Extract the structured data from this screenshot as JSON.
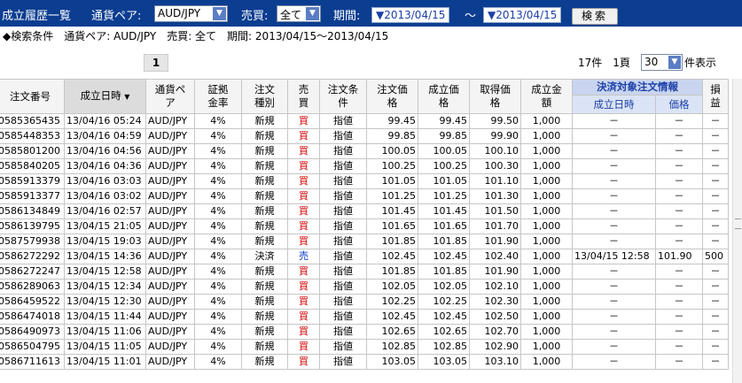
{
  "header": {
    "title": "成立履歴一覧",
    "currency_label": "通貨ペア:",
    "currency_value": "AUD/JPY",
    "side_label": "売買:",
    "side_value": "全て",
    "period_label": "期間:",
    "date_from": "▼2013/04/15",
    "tilde": "～",
    "date_to": "▼2013/04/15",
    "search_button": "検索"
  },
  "conditions": "◆検索条件　通貨ペア: AUD/JPY　売買: 全て　期間: 2013/04/15～2013/04/15",
  "pager": {
    "current_page": "1",
    "summary": "17件　1頁",
    "per_page_value": "30",
    "per_page_suffix": "件表示"
  },
  "table": {
    "headers": {
      "order_no": "注文番号",
      "date": "成立日時",
      "sort_arrow": "▼",
      "pair": [
        "通貨ペ",
        "ア"
      ],
      "margin": [
        "証拠",
        "金率"
      ],
      "type": [
        "注文",
        "種別"
      ],
      "side": [
        "売",
        "買"
      ],
      "condition": [
        "注文条",
        "件"
      ],
      "order_price": [
        "注文価",
        "格"
      ],
      "exec_price": [
        "成立価",
        "格"
      ],
      "acq_price": [
        "取得価",
        "格"
      ],
      "amount": [
        "成立金",
        "額"
      ],
      "settle_group": "決済対象注文情報",
      "settle_date": "成立日時",
      "settle_price": "価格",
      "pl": [
        "損",
        "益"
      ]
    },
    "rows": [
      [
        "0585365435",
        "13/04/16 05:24",
        "AUD/JPY",
        "4%",
        "新規",
        "買",
        "指値",
        "99.45",
        "99.45",
        "99.50",
        "1,000",
        "－",
        "－",
        "－"
      ],
      [
        "0585448353",
        "13/04/16 04:59",
        "AUD/JPY",
        "4%",
        "新規",
        "買",
        "指値",
        "99.85",
        "99.85",
        "99.90",
        "1,000",
        "－",
        "－",
        "－"
      ],
      [
        "0585801200",
        "13/04/16 04:56",
        "AUD/JPY",
        "4%",
        "新規",
        "買",
        "指値",
        "100.05",
        "100.05",
        "100.10",
        "1,000",
        "－",
        "－",
        "－"
      ],
      [
        "0585840205",
        "13/04/16 04:36",
        "AUD/JPY",
        "4%",
        "新規",
        "買",
        "指値",
        "100.25",
        "100.25",
        "100.30",
        "1,000",
        "－",
        "－",
        "－"
      ],
      [
        "0585913379",
        "13/04/16 03:03",
        "AUD/JPY",
        "4%",
        "新規",
        "買",
        "指値",
        "101.05",
        "101.05",
        "101.10",
        "1,000",
        "－",
        "－",
        "－"
      ],
      [
        "0585913377",
        "13/04/16 03:02",
        "AUD/JPY",
        "4%",
        "新規",
        "買",
        "指値",
        "101.25",
        "101.25",
        "101.30",
        "1,000",
        "－",
        "－",
        "－"
      ],
      [
        "0586134849",
        "13/04/16 02:57",
        "AUD/JPY",
        "4%",
        "新規",
        "買",
        "指値",
        "101.45",
        "101.45",
        "101.50",
        "1,000",
        "－",
        "－",
        "－"
      ],
      [
        "0586139795",
        "13/04/15 21:05",
        "AUD/JPY",
        "4%",
        "新規",
        "買",
        "指値",
        "101.65",
        "101.65",
        "101.70",
        "1,000",
        "－",
        "－",
        "－"
      ],
      [
        "0587579938",
        "13/04/15 19:03",
        "AUD/JPY",
        "4%",
        "新規",
        "買",
        "指値",
        "101.85",
        "101.85",
        "101.90",
        "1,000",
        "－",
        "－",
        "－"
      ],
      [
        "0586272292",
        "13/04/15 14:36",
        "AUD/JPY",
        "4%",
        "決済",
        "売",
        "指値",
        "102.45",
        "102.45",
        "102.40",
        "1,000",
        "13/04/15 12:58",
        "101.90",
        "500"
      ],
      [
        "0586272247",
        "13/04/15 12:58",
        "AUD/JPY",
        "4%",
        "新規",
        "買",
        "指値",
        "101.85",
        "101.85",
        "101.90",
        "1,000",
        "－",
        "－",
        "－"
      ],
      [
        "0586289063",
        "13/04/15 12:34",
        "AUD/JPY",
        "4%",
        "新規",
        "買",
        "指値",
        "102.05",
        "102.05",
        "102.10",
        "1,000",
        "－",
        "－",
        "－"
      ],
      [
        "0586459522",
        "13/04/15 12:30",
        "AUD/JPY",
        "4%",
        "新規",
        "買",
        "指値",
        "102.25",
        "102.25",
        "102.30",
        "1,000",
        "－",
        "－",
        "－"
      ],
      [
        "0586474018",
        "13/04/15 11:44",
        "AUD/JPY",
        "4%",
        "新規",
        "買",
        "指値",
        "102.45",
        "102.45",
        "102.50",
        "1,000",
        "－",
        "－",
        "－"
      ],
      [
        "0586490973",
        "13/04/15 11:06",
        "AUD/JPY",
        "4%",
        "新規",
        "買",
        "指値",
        "102.65",
        "102.65",
        "102.70",
        "1,000",
        "－",
        "－",
        "－"
      ],
      [
        "0586504795",
        "13/04/15 11:05",
        "AUD/JPY",
        "4%",
        "新規",
        "買",
        "指値",
        "102.85",
        "102.85",
        "102.90",
        "1,000",
        "－",
        "－",
        "－"
      ],
      [
        "0586711613",
        "13/04/15 11:01",
        "AUD/JPY",
        "4%",
        "新規",
        "買",
        "指値",
        "103.05",
        "103.05",
        "103.10",
        "1,000",
        "－",
        "－",
        "－"
      ]
    ]
  },
  "colors": {
    "topbar": "#0b3d91",
    "buy": "#d40000",
    "sell": "#0033cc"
  }
}
